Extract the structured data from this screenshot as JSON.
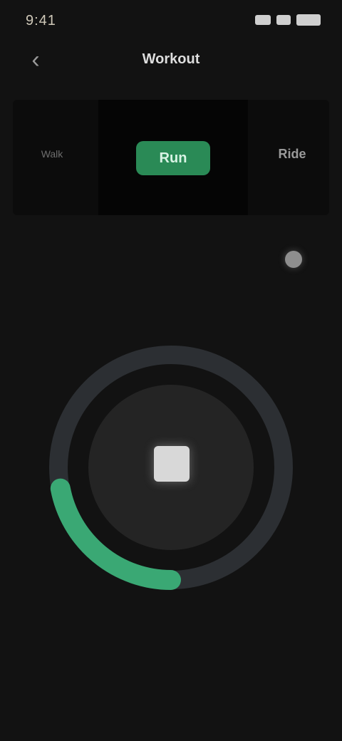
{
  "status_bar": {
    "time": "9:41",
    "icons": [
      "signal-icon",
      "wifi-icon",
      "battery-icon"
    ]
  },
  "toolbar": {
    "back_icon": "chevron-left-icon",
    "title": "Workout"
  },
  "modes": {
    "left": {
      "label": "Walk",
      "sub": ""
    },
    "center": {
      "top": "",
      "label": "Run",
      "sub": ""
    },
    "right": {
      "label": "Ride"
    }
  },
  "dial": {
    "progress": 0.22,
    "track_color": "#2c2f33",
    "progress_color": "#3aa874",
    "inner_color": "#242424"
  },
  "controls": {
    "settings_icon": "settings-dot-icon",
    "stop_icon": "stop-icon"
  },
  "colors": {
    "background": "#121212",
    "accent": "#2a8a56"
  }
}
